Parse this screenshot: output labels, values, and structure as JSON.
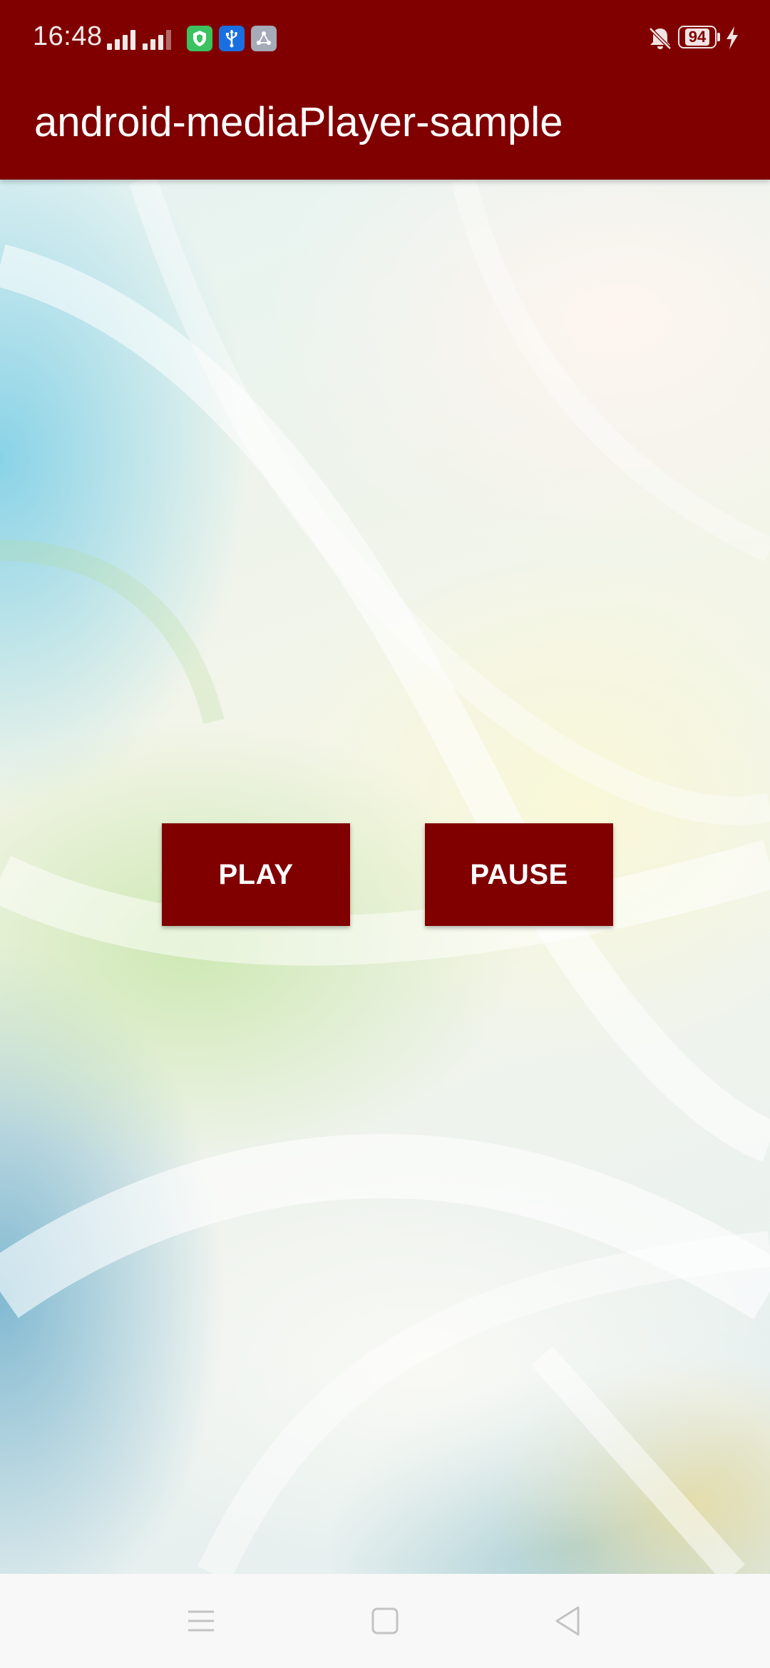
{
  "status_bar": {
    "time": "16:48",
    "battery_level": "94",
    "icons": [
      "signal-icon",
      "signal-icon",
      "shield-icon",
      "usb-icon",
      "share-icon",
      "bell-off-icon",
      "battery-icon",
      "charging-icon"
    ]
  },
  "app_bar": {
    "title": "android-mediaPlayer-sample"
  },
  "controls": {
    "play_label": "PLAY",
    "pause_label": "PAUSE"
  },
  "nav_bar": {
    "icons": [
      "menu-icon",
      "home-icon",
      "back-icon"
    ]
  },
  "colors": {
    "primary": "#800000",
    "on_primary": "#ffffff",
    "nav_background": "#f8f8f8"
  }
}
